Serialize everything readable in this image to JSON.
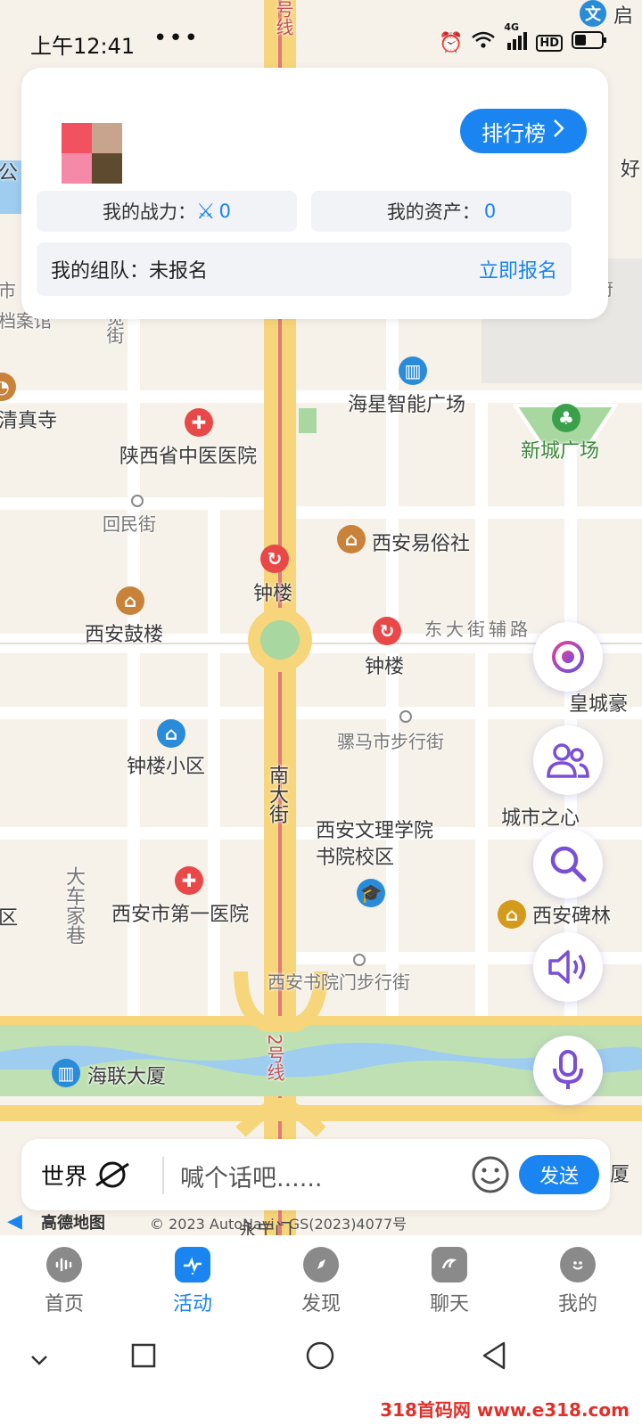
{
  "status_bar": {
    "time": "上午12:41",
    "more": "•••",
    "network": "4G",
    "hd": "HD"
  },
  "map": {
    "labels": {
      "line2_top": "号线",
      "haixing": "海星智能广场",
      "xincheng": "新城广场",
      "qingzhen": "清真寺",
      "tcm_hospital": "陕西省中医医院",
      "huimin": "回民街",
      "yisu": "西安易俗社",
      "zhonglou_metro": "钟楼",
      "gulou": "西安鼓楼",
      "dongdajie": "东大街辅路",
      "zhonglou2": "钟楼",
      "huangcheng": "皇城豪",
      "luomashi": "骡马市步行街",
      "zhonglou_xiaoqu": "钟楼小区",
      "nandajie": "南大街",
      "chengshi": "城市之心",
      "wenli": "西安文理学院书院校区",
      "dajiache": "大车家巷",
      "first_hospital": "西安市第一医院",
      "beilin": "西安碑林",
      "shuyuan": "西安书院门步行街",
      "line2_bottom": "2号线",
      "hailian": "海联大厦",
      "qu": "区",
      "sha": "厦",
      "shi": "市",
      "dangan": "档案馆",
      "jue": "觉街",
      "fu": "府",
      "gong": "公",
      "hao": "好",
      "wen": "文",
      "qi": "启"
    }
  },
  "card": {
    "ranking_label": "排行榜",
    "power_label": "我的战力：",
    "power_value": "0",
    "assets_label": "我的资产：",
    "assets_value": "0",
    "team_label": "我的组队：未报名",
    "signup_label": "立即报名"
  },
  "chat": {
    "channel": "世界",
    "placeholder": "喊个话吧......",
    "send_label": "发送"
  },
  "attribution": {
    "brand": "高德地图",
    "copyright": "© 2023 AutoNavi - GS(2023)4077号",
    "yongning": "永宁门"
  },
  "nav": {
    "items": [
      {
        "label": "首页",
        "icon": "voice-wave-icon"
      },
      {
        "label": "活动",
        "icon": "activity-icon"
      },
      {
        "label": "发现",
        "icon": "compass-icon"
      },
      {
        "label": "聊天",
        "icon": "chat-icon"
      },
      {
        "label": "我的",
        "icon": "profile-icon"
      }
    ],
    "active_index": 1
  },
  "watermark": "318首码网 www.e318.com",
  "colors": {
    "accent": "#1a84f0",
    "fab_purple": "#7a4fd6"
  }
}
